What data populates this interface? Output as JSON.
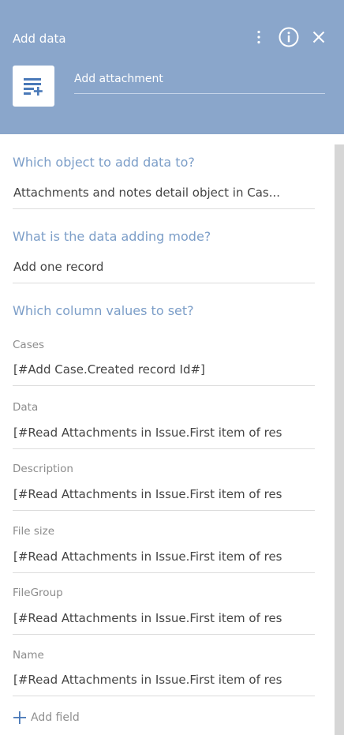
{
  "header": {
    "title": "Add data",
    "caption_value": "Add attachment",
    "icons": {
      "menu": "kebab-menu-icon",
      "info": "info-icon",
      "close": "close-icon",
      "element": "add-data-element-icon"
    }
  },
  "questions": {
    "object": "Which object to add data to?",
    "mode": "What is the data adding mode?",
    "columns": "Which column values to set?"
  },
  "object_value": "Attachments and notes detail object in Cas...",
  "mode_value": "Add one record",
  "columns": [
    {
      "label": "Cases",
      "value": "[#Add Case.Created record Id#]"
    },
    {
      "label": "Data",
      "value": "[#Read Attachments in Issue.First item of res"
    },
    {
      "label": "Description",
      "value": "[#Read Attachments in Issue.First item of res"
    },
    {
      "label": "File size",
      "value": "[#Read Attachments in Issue.First item of res"
    },
    {
      "label": "FileGroup",
      "value": "[#Read Attachments in Issue.First item of res"
    },
    {
      "label": "Name",
      "value": "[#Read Attachments in Issue.First item of res"
    }
  ],
  "add_field_label": "Add field",
  "colors": {
    "header_bg": "#8aa6cb",
    "question": "#7c9ec8",
    "accent": "#4a79b8"
  }
}
